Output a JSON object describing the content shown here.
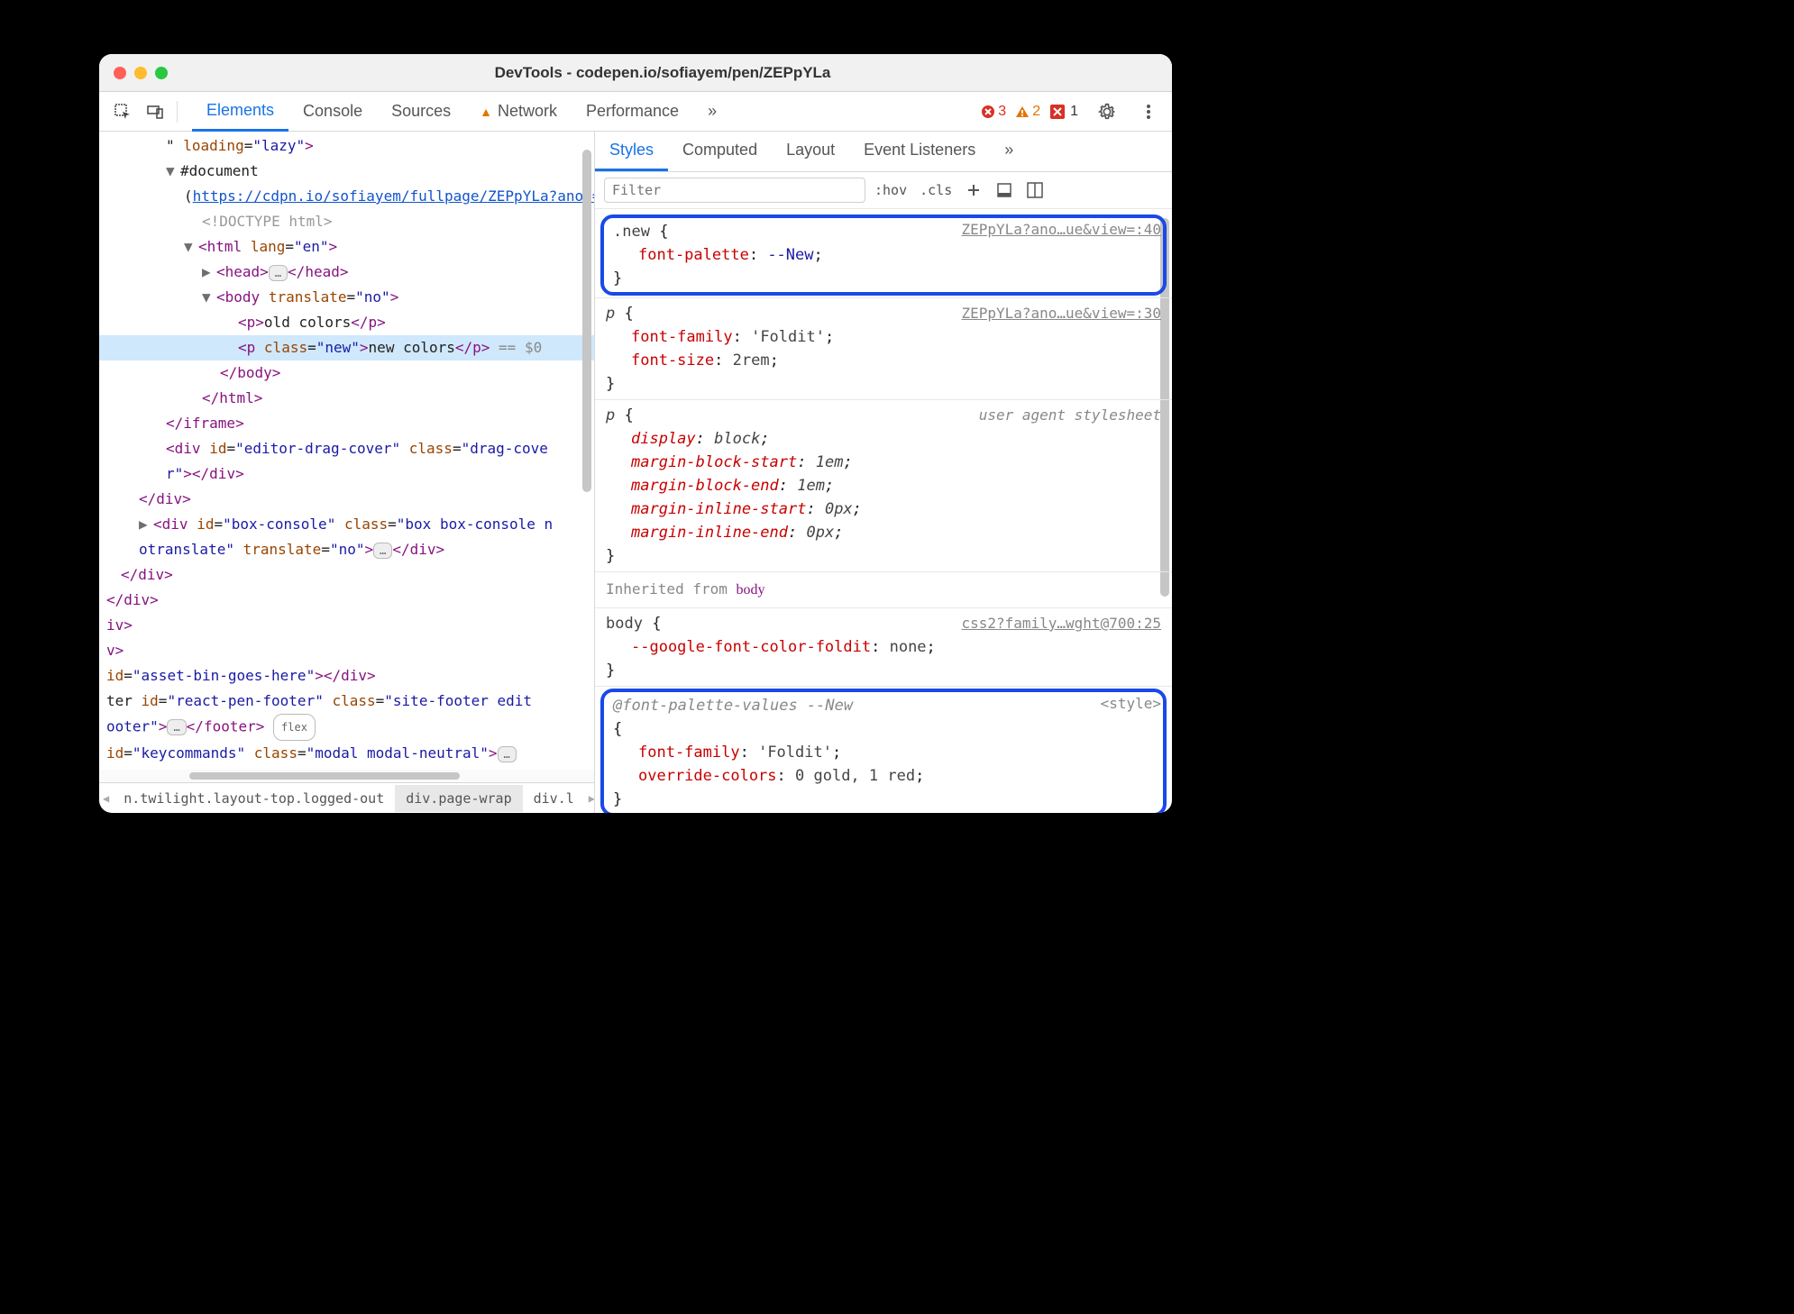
{
  "window": {
    "title": "DevTools - codepen.io/sofiayem/pen/ZEPpYLa"
  },
  "mainTabs": {
    "items": [
      "Elements",
      "Console",
      "Sources",
      "Network",
      "Performance"
    ],
    "active": 0,
    "networkWarning": true,
    "more": "»"
  },
  "statusBadges": {
    "errors": "3",
    "warnings": "2",
    "info": "1"
  },
  "dom": {
    "line0": {
      "attr": "loading",
      "val": "\"lazy\"",
      "close": ">"
    },
    "line1": {
      "tri": "▼",
      "tag": "#document"
    },
    "line2": {
      "open": "(",
      "url": "https://cdpn.io/sofiayem/fullpage/ZEPpYLa?anon=true&view=",
      "close": ")"
    },
    "line3": {
      "txt": "<!DOCTYPE html>"
    },
    "line4": {
      "tri": "▼",
      "open": "<",
      "tag": "html",
      "attr": "lang",
      "val": "\"en\"",
      "close": ">"
    },
    "line5": {
      "tri": "▶",
      "open": "<",
      "tag": "head",
      "close": ">",
      "ellipsis": "…",
      "closeTag": "</head>"
    },
    "line6": {
      "tri": "▼",
      "open": "<",
      "tag": "body",
      "attr": "translate",
      "val": "\"no\"",
      "close": ">"
    },
    "line7": {
      "open": "<",
      "tag": "p",
      "close": ">",
      "txt": "old colors",
      "closeTag": "</p>"
    },
    "line8": {
      "open": "<",
      "tag": "p",
      "attr": "class",
      "val": "\"new\"",
      "close": ">",
      "txt": "new colors",
      "closeTag": "</p>",
      "after": " == $0"
    },
    "line9": {
      "closeTag": "</body>"
    },
    "line10": {
      "closeTag": "</html>"
    },
    "line11": {
      "closeTag": "</iframe>"
    },
    "line12a": {
      "open": "<",
      "tag": "div",
      "attr1": "id",
      "val1": "\"editor-drag-cover\"",
      "attr2": "class",
      "val2": "\"drag-cove"
    },
    "line12b": {
      "valCont": "r\"",
      "close": ">",
      "closeTag": "</div>"
    },
    "line13": {
      "closeTag": "</div>"
    },
    "line14a": {
      "tri": "▶",
      "open": "<",
      "tag": "div",
      "attr1": "id",
      "val1": "\"box-console\"",
      "attr2": "class",
      "val2": "\"box box-console n"
    },
    "line14b": {
      "valCont": "otranslate\"",
      "attr3": "translate",
      "val3": "\"no\"",
      "close": ">",
      "ellipsis": "…",
      "closeTag": "</div>"
    },
    "line15": {
      "closeTag": "</div>"
    },
    "line16": {
      "closeTag": "</div>"
    },
    "line17": {
      "txt": "iv>"
    },
    "line18": {
      "txt": "v>"
    },
    "line19": {
      "attr": "id",
      "val": "\"asset-bin-goes-here\"",
      "close": ">",
      "closeTag": "</div>"
    },
    "line20a": {
      "txt1": "ter ",
      "attr1": "id",
      "val1": "\"react-pen-footer\"",
      "attr2": "class",
      "val2": "\"site-footer edit"
    },
    "line20b": {
      "valCont": "ooter\"",
      "close": ">",
      "ellipsis": "…",
      "closeTag": "</footer>",
      "flex": "flex"
    },
    "line21": {
      "attr1": "id",
      "val1": "\"keycommands\"",
      "attr2": "class",
      "val2": "\"modal modal-neutral\"",
      "close": ">",
      "ellipsis": "…"
    }
  },
  "crumbs": {
    "c0": "n.twilight.layout-top.logged-out",
    "c1": "div.page-wrap",
    "c2": "div.l"
  },
  "subTabs": {
    "items": [
      "Styles",
      "Computed",
      "Layout",
      "Event Listeners"
    ],
    "active": 0,
    "more": "»"
  },
  "filter": {
    "placeholder": "Filter",
    "hov": ":hov",
    "cls": ".cls"
  },
  "rules": {
    "r0": {
      "sel": ".new",
      "src": "ZEPpYLa?ano…ue&view=:40",
      "p0": "font-palette",
      "v0": "--New"
    },
    "r1": {
      "sel": "p",
      "src": "ZEPpYLa?ano…ue&view=:30",
      "p0": "font-family",
      "v0": "'Foldit'",
      "p1": "font-size",
      "v1": "2rem"
    },
    "r2": {
      "sel": "p",
      "src": "user agent stylesheet",
      "p0": "display",
      "v0": "block",
      "p1": "margin-block-start",
      "v1": "1em",
      "p2": "margin-block-end",
      "v2": "1em",
      "p3": "margin-inline-start",
      "v3": "0px",
      "p4": "margin-inline-end",
      "v4": "0px"
    },
    "inherit": {
      "label": "Inherited from ",
      "from": "body"
    },
    "r3": {
      "sel": "body",
      "src": "css2?family…wght@700:25",
      "p0": "--google-font-color-foldit",
      "v0": "none"
    },
    "r4": {
      "sel": "@font-palette-values --New",
      "src": "<style>",
      "p0": "font-family",
      "v0": "'Foldit'",
      "p1": "override-colors",
      "v1": "0 gold, 1 red"
    }
  }
}
